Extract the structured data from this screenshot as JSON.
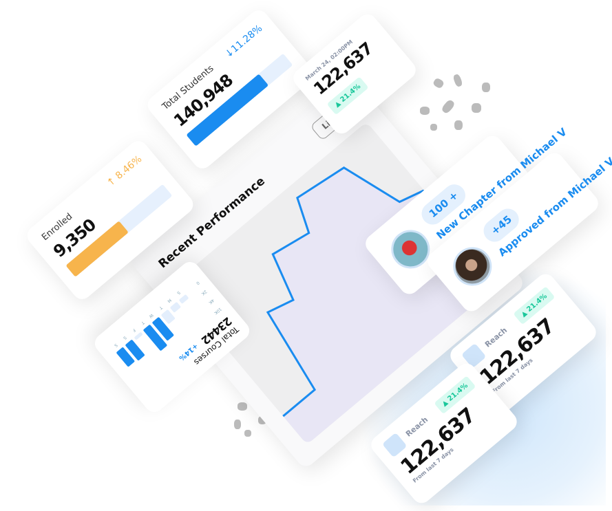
{
  "enrolled": {
    "label": "Enrolled",
    "value": "9,350",
    "change": "8.46%",
    "direction": "up",
    "progress": 0.55,
    "color": "#f7b44c"
  },
  "total_students": {
    "label": "Total Students",
    "value": "140,948",
    "change": "11.28%",
    "direction": "down",
    "progress": 0.75,
    "color": "#1a8cf0"
  },
  "snapshot": {
    "date": "March 24, 02:00PM",
    "value": "122,637",
    "change": "21.4%"
  },
  "performance": {
    "title": "Recent Performance",
    "live_button": "Live P"
  },
  "notifications": [
    {
      "pill": "100 +",
      "message": "New Chapter from Michael V"
    },
    {
      "pill": "+45",
      "message": "Approved from Michael V"
    }
  ],
  "reach_cards": [
    {
      "label": "Reach",
      "value": "122,637",
      "subtitle": "From last 7 days",
      "change": "21.4%"
    },
    {
      "label": "Reach",
      "value": "122,637",
      "subtitle": "From last 7 days",
      "change": "21.4%"
    }
  ],
  "courses": {
    "label": "Total Courses",
    "value": "23442",
    "change": "+14%",
    "chart_data": {
      "type": "bar",
      "categories": [
        "S",
        "M",
        "T",
        "W",
        "T",
        "F",
        "S",
        "S"
      ],
      "values": [
        1.5,
        2,
        3.5,
        7,
        8,
        1,
        6,
        5.5
      ],
      "yticks": [
        "0",
        "2K",
        "4K",
        "10K"
      ],
      "ylim": [
        0,
        10
      ]
    }
  },
  "colors": {
    "accent": "#1a8cf0",
    "orange": "#f7b44c",
    "green": "#19c79a"
  }
}
